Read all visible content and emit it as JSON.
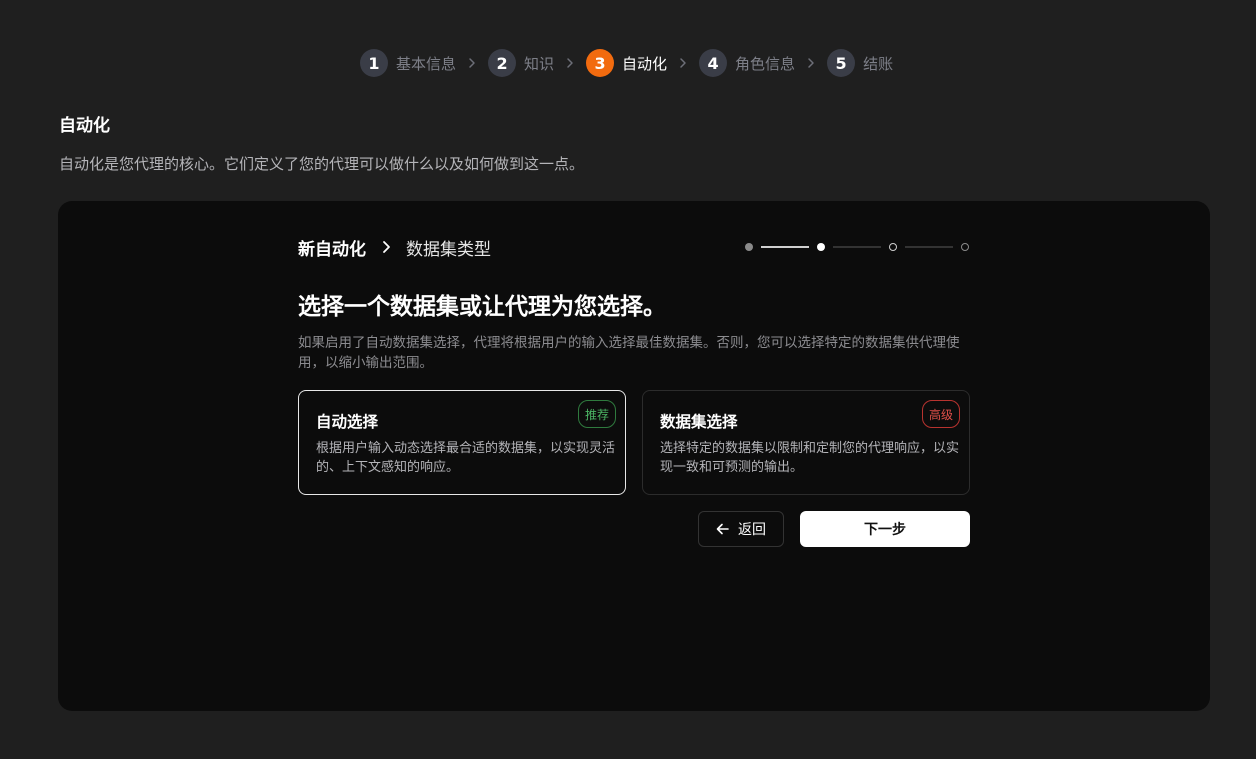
{
  "stepper": {
    "steps": [
      {
        "number": "1",
        "label": "基本信息"
      },
      {
        "number": "2",
        "label": "知识"
      },
      {
        "number": "3",
        "label": "自动化",
        "active": true
      },
      {
        "number": "4",
        "label": "角色信息"
      },
      {
        "number": "5",
        "label": "结账"
      }
    ],
    "active_color": "#f26b0f"
  },
  "section": {
    "title": "自动化",
    "description": "自动化是您代理的核心。它们定义了您的代理可以做什么以及如何做到这一点。"
  },
  "wizard": {
    "breadcrumb": {
      "root": "新自动化",
      "current": "数据集类型"
    },
    "progress": {
      "total_steps": 4,
      "current_step": 2
    },
    "question": "选择一个数据集或让代理为您选择。",
    "explanation": "如果启用了自动数据集选择，代理将根据用户的输入选择最佳数据集。否则，您可以选择特定的数据集供代理使用，以缩小输出范围。",
    "options": [
      {
        "title": "自动选择",
        "description": "根据用户输入动态选择最合适的数据集，以实现灵活的、上下文感知的响应。",
        "badge": "推荐",
        "badge_color": "#4bb464",
        "selected": true
      },
      {
        "title": "数据集选择",
        "description": "选择特定的数据集以限制和定制您的代理响应，以实现一致和可预测的输出。",
        "badge": "高级",
        "badge_color": "#e04f49",
        "selected": false
      }
    ],
    "back_label": "返回",
    "next_label": "下一步"
  }
}
